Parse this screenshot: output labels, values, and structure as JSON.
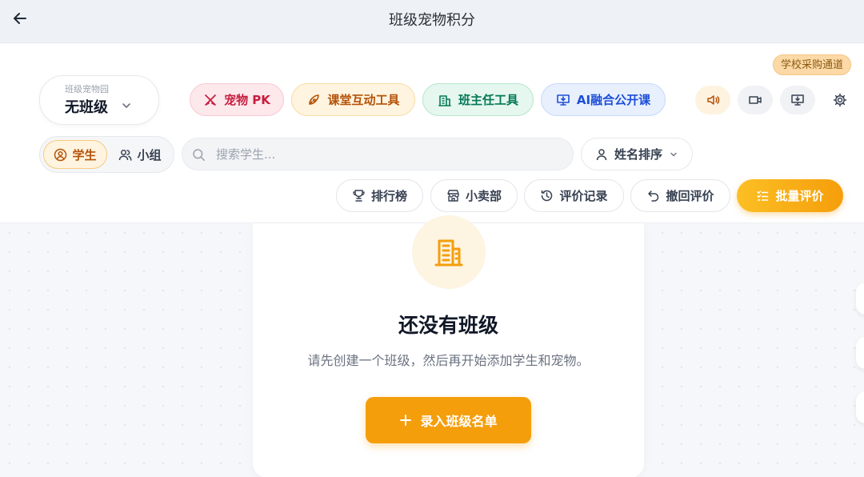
{
  "topbar": {
    "title": "班级宠物积分"
  },
  "procurement_label": "学校采购通道",
  "class_selector": {
    "caption": "班级宠物园",
    "value": "无班级"
  },
  "feature_pills": [
    {
      "label": "宠物 PK",
      "icon": "swords-icon"
    },
    {
      "label": "课堂互动工具",
      "icon": "rocket-icon"
    },
    {
      "label": "班主任工具",
      "icon": "building-icon"
    },
    {
      "label": "AI融合公开课",
      "icon": "screen-download-icon"
    }
  ],
  "icon_buttons": [
    "speaker-icon",
    "video-camera-icon",
    "monitor-download-icon",
    "gear-icon"
  ],
  "view_toggle": {
    "student": "学生",
    "group": "小组",
    "selected": "student"
  },
  "search": {
    "placeholder": "搜索学生...",
    "value": ""
  },
  "sort": {
    "label": "姓名排序"
  },
  "actions": {
    "rank": "排行榜",
    "shop": "小卖部",
    "log": "评价记录",
    "undo": "撤回评价",
    "batch": "批量评价"
  },
  "empty_state": {
    "title": "还没有班级",
    "description": "请先创建一个班级，然后再开始添加学生和宠物。",
    "cta": "录入班级名单"
  },
  "colors": {
    "accent": "#f59e0b",
    "topbar_bg": "#eef2f6",
    "pk": "#c81d3e",
    "tools": "#b45309",
    "head": "#047857",
    "ai": "#1d4ed8"
  }
}
